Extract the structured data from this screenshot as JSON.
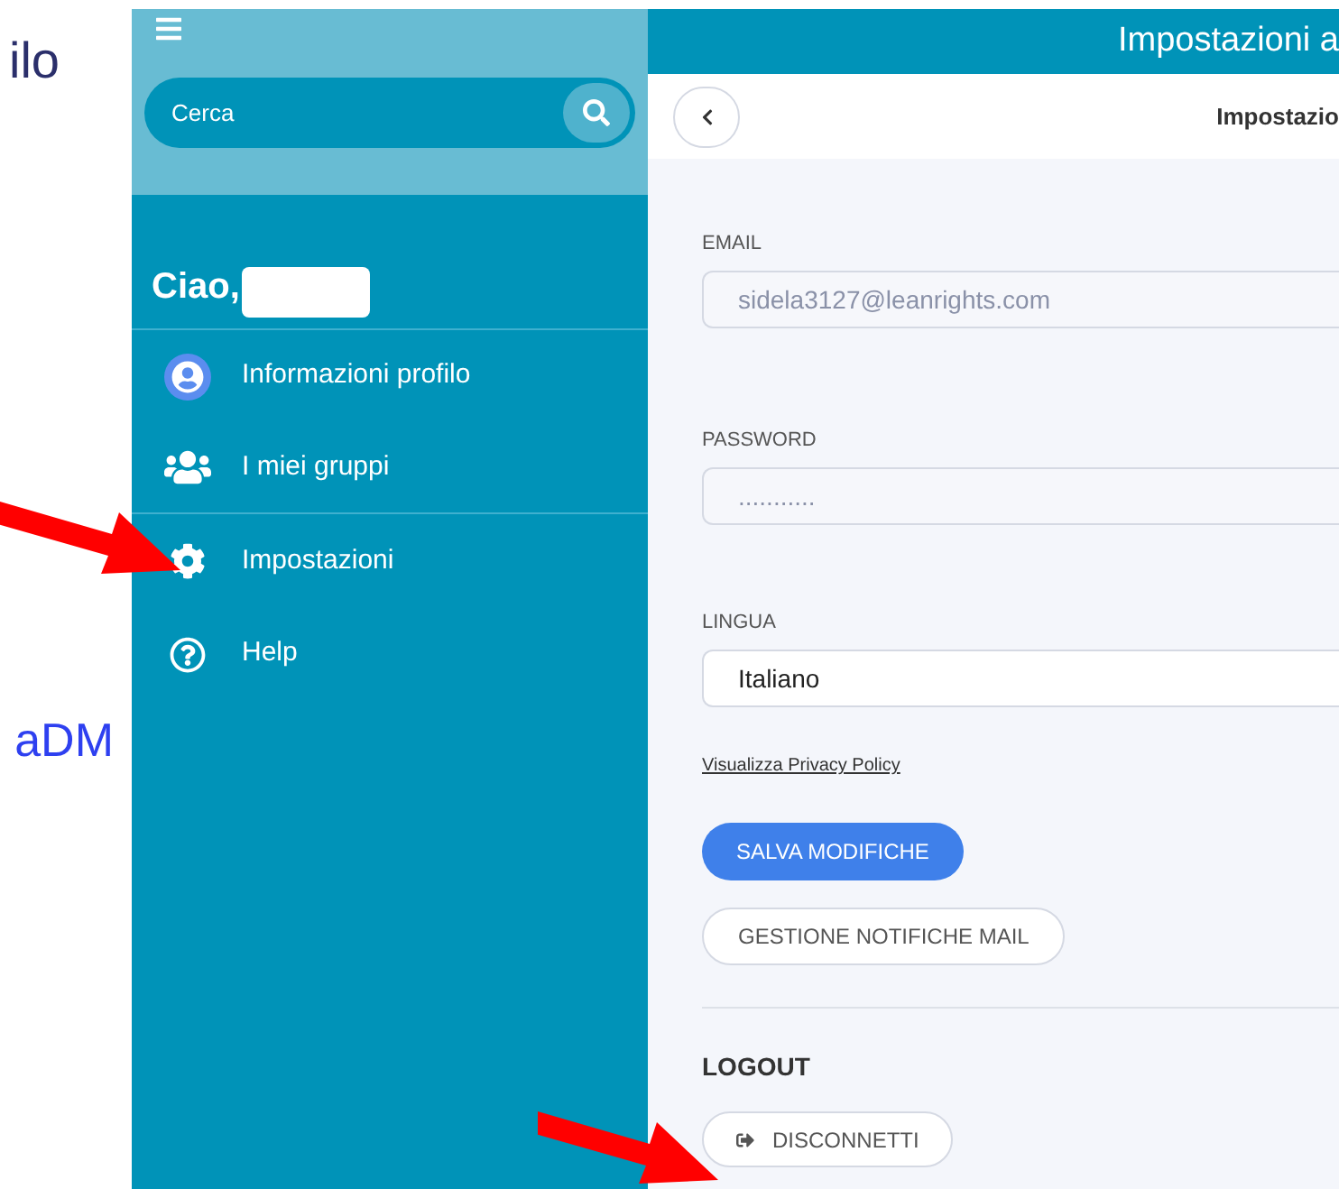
{
  "background_text": [
    "ilo",
    "aDM"
  ],
  "sidebar": {
    "search": {
      "placeholder": "Cerca"
    },
    "greeting": "Ciao,",
    "items": [
      {
        "kind": "avatar",
        "label": "Informazioni profilo",
        "divider_after": false
      },
      {
        "kind": "group",
        "label": "I miei gruppi",
        "divider_after": true
      },
      {
        "kind": "gear",
        "label": "Impostazioni",
        "divider_after": false
      },
      {
        "kind": "help",
        "label": "Help",
        "divider_after": false
      }
    ]
  },
  "header": {
    "title": "Impostazioni a"
  },
  "subheader": {
    "title": "Impostazio"
  },
  "form": {
    "fields": [
      {
        "kind": "readonly",
        "label": "EMAIL",
        "value": "sidela3127@leanrights.com"
      },
      {
        "kind": "readonly",
        "label": "PASSWORD",
        "value": "..........."
      },
      {
        "kind": "select",
        "label": "LINGUA",
        "value": "Italiano"
      }
    ],
    "privacy_link": "Visualizza Privacy Policy",
    "buttons": [
      {
        "kind": "primary",
        "label": "SALVA MODIFICHE"
      },
      {
        "kind": "outline",
        "label": "GESTIONE NOTIFICHE MAIL"
      }
    ]
  },
  "logout": {
    "heading": "LOGOUT",
    "button": "DISCONNETTI"
  }
}
